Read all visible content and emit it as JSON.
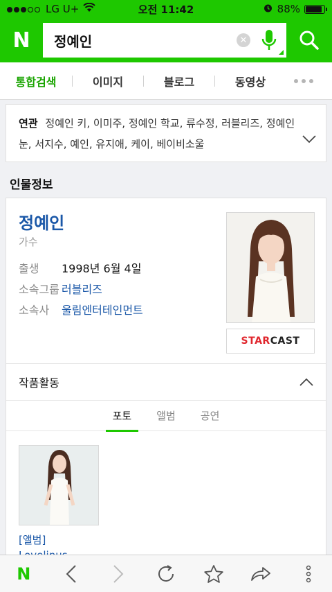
{
  "status_bar": {
    "carrier": "LG U+",
    "time": "오전 11:42",
    "battery": "88%",
    "battery_level": 0.88
  },
  "search": {
    "logo": "N",
    "query": "정예인",
    "clear_icon": "close-icon",
    "mic_icon": "microphone-icon",
    "search_icon": "search-icon"
  },
  "tabs": [
    {
      "label": "통합검색",
      "active": true
    },
    {
      "label": "이미지"
    },
    {
      "label": "블로그"
    },
    {
      "label": "동영상"
    }
  ],
  "related": {
    "label": "연관",
    "terms": "정예인 키, 이미주, 정예인 학교, 류수정, 러블리즈, 정예인 눈, 서지수, 예인, 유지애, 케이, 베이비소울"
  },
  "section_title": "인물정보",
  "person": {
    "name": "정예인",
    "job": "가수",
    "info": [
      {
        "key": "출생",
        "value": "1998년 6월 4일",
        "link": false
      },
      {
        "key": "소속그룹",
        "value": "러블리즈",
        "link": true
      },
      {
        "key": "소속사",
        "value": "울림엔터테인먼트",
        "link": true
      }
    ],
    "partner_red": "STAR",
    "partner_black": "CAST"
  },
  "works": {
    "title": "작품활동",
    "subtabs": [
      {
        "label": "포토",
        "active": true
      },
      {
        "label": "앨범"
      },
      {
        "label": "공연"
      }
    ],
    "album_label": "[앨범]",
    "album_title": "Lovelinus"
  },
  "colors": {
    "brand_green": "#1ec800",
    "link_blue": "#1b58a8",
    "starcast_red": "#e0262d"
  },
  "toolbar": {
    "items": [
      "naver-home-icon",
      "back-icon",
      "forward-icon",
      "refresh-icon",
      "bookmark-star-icon",
      "share-icon",
      "more-vertical-icon"
    ]
  }
}
